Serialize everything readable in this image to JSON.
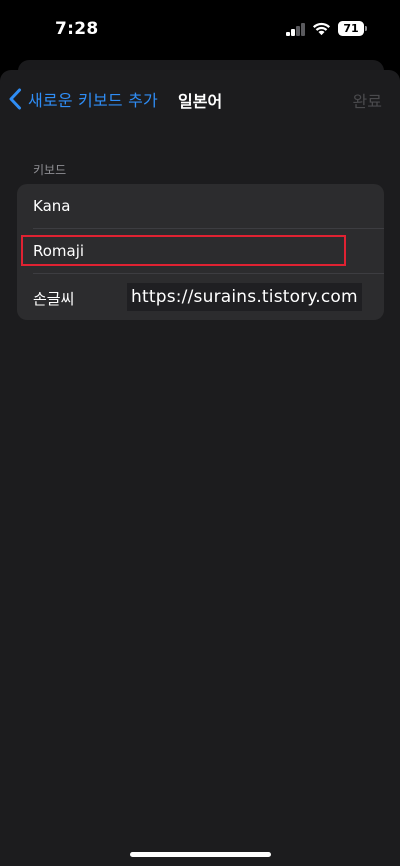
{
  "status_bar": {
    "time": "7:28",
    "battery_level": "71",
    "signal_bars_active": 2,
    "signal_bars_total": 4
  },
  "nav": {
    "back_label": "새로운 키보드 추가",
    "title": "일본어",
    "done_label": "완료"
  },
  "section": {
    "header": "키보드",
    "items": [
      {
        "label": "Kana"
      },
      {
        "label": "Romaji"
      },
      {
        "label": "손글씨"
      }
    ]
  },
  "watermark": {
    "text": "https://surains.tistory.com"
  },
  "colors": {
    "accent": "#2f8df5",
    "highlight": "#e02232",
    "background": "#1c1c1e",
    "cell": "#2c2c2e"
  }
}
